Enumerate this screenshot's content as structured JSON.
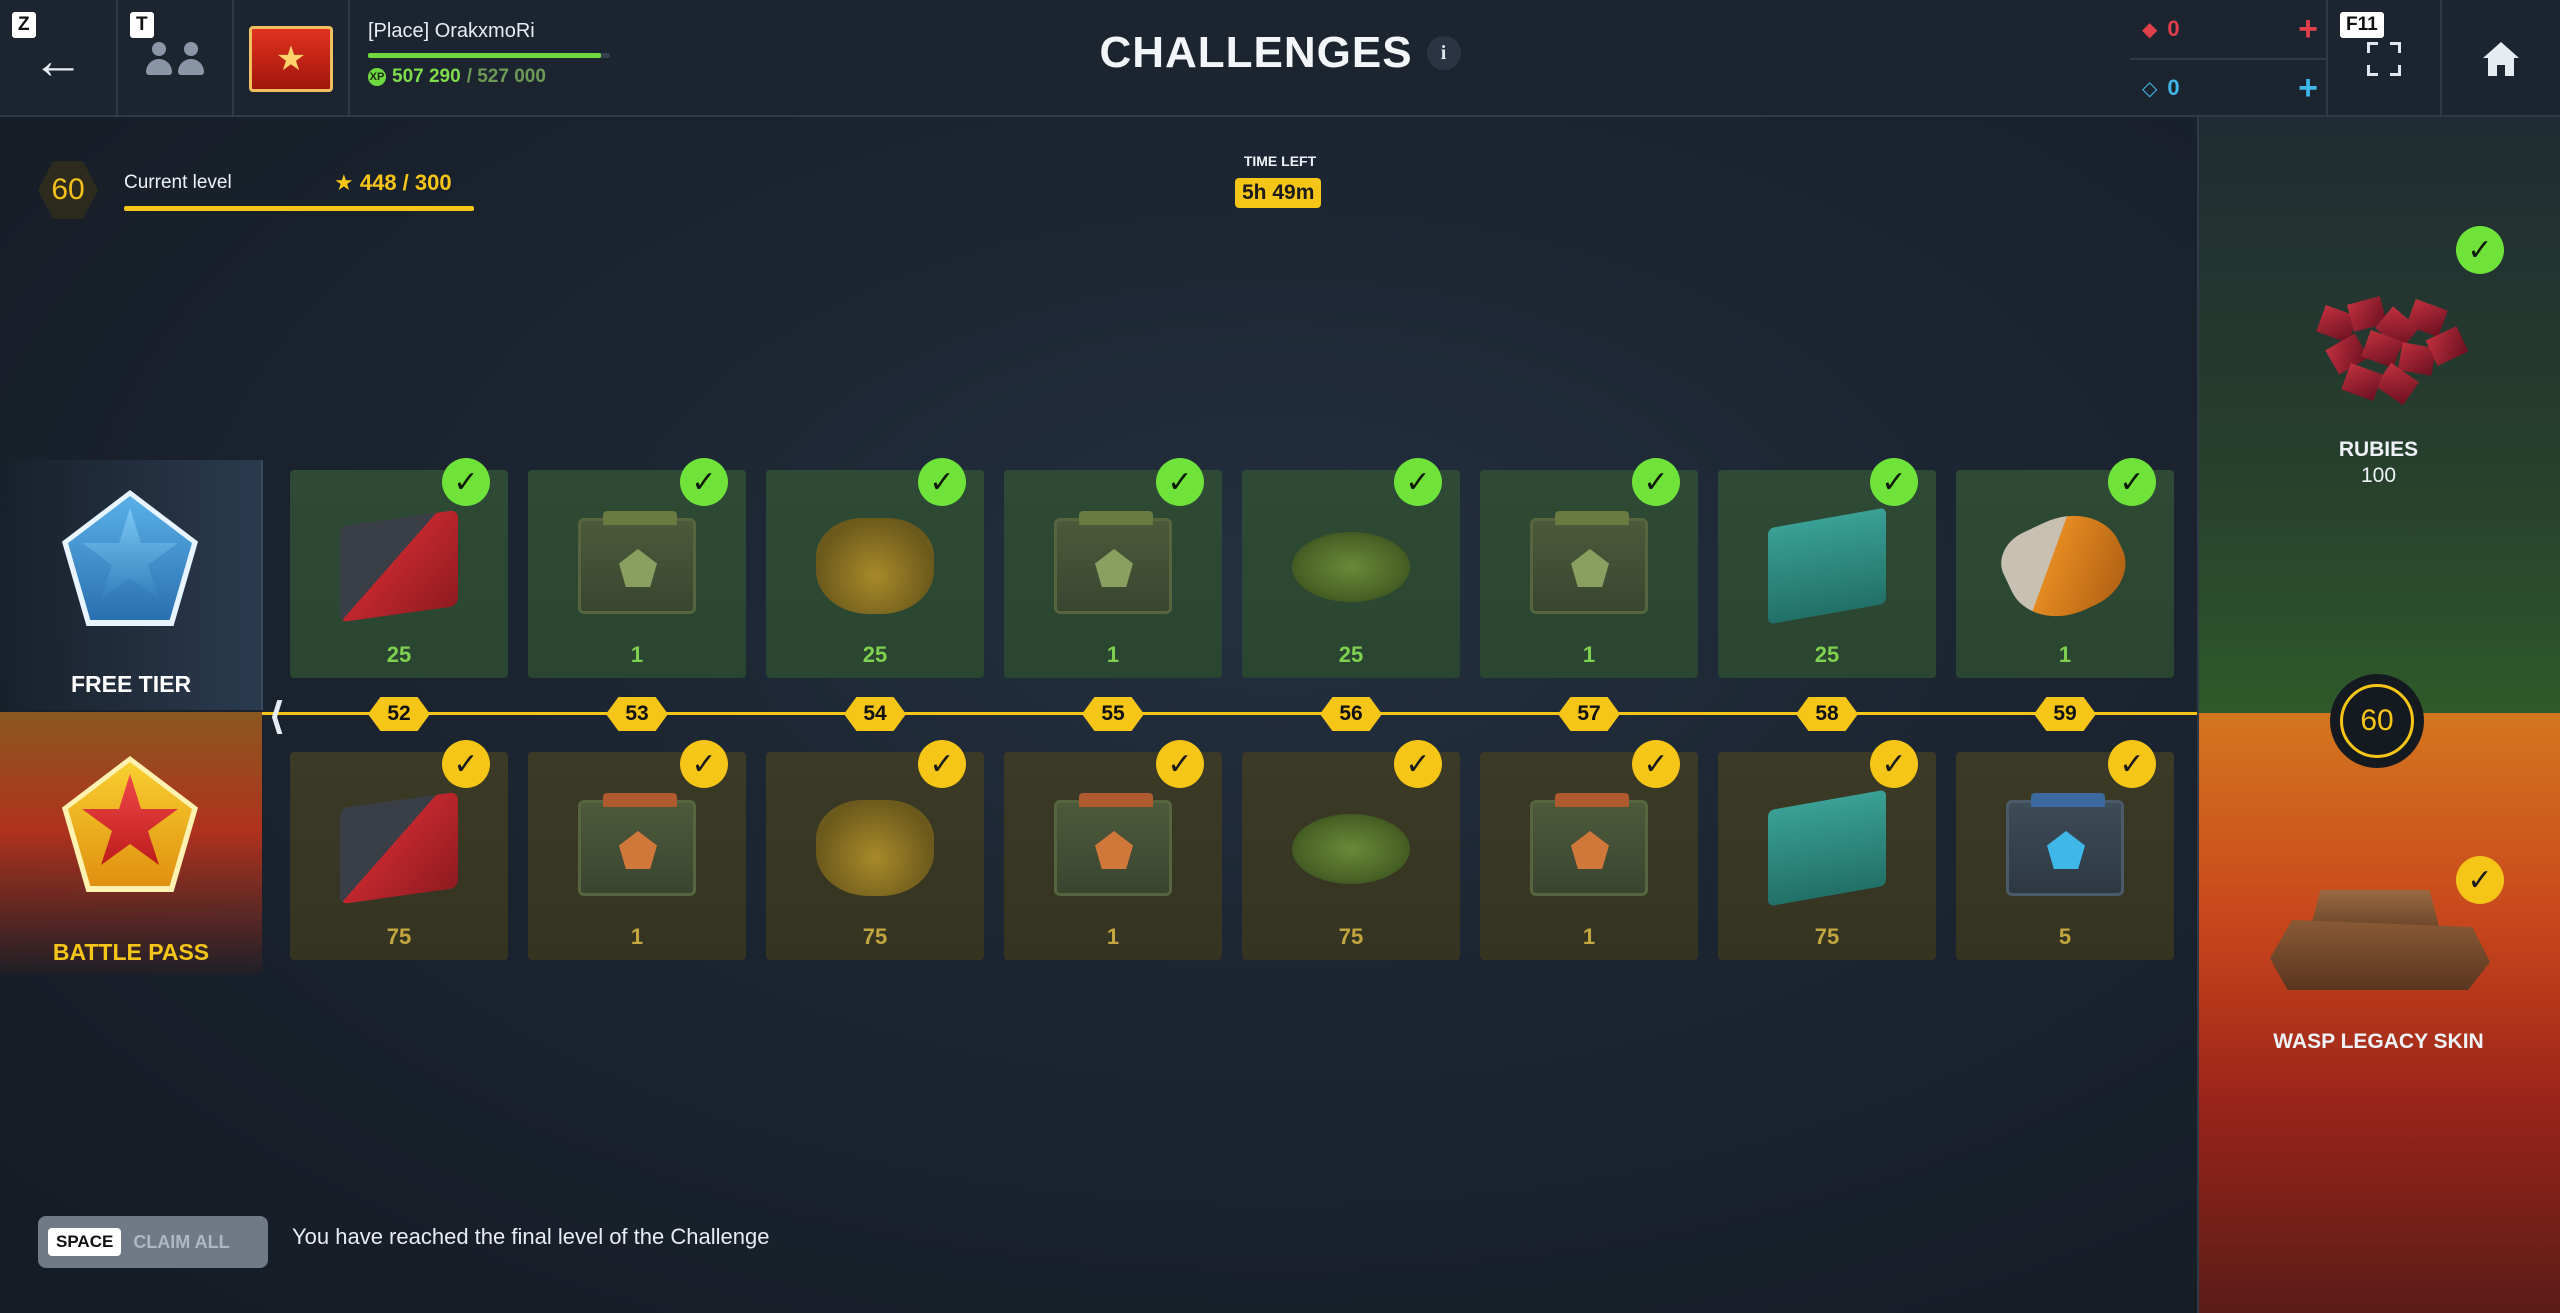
{
  "header": {
    "back_key": "Z",
    "friends_key": "T",
    "fullscreen_key": "F11",
    "title": "CHALLENGES",
    "info_glyph": "i",
    "profile": {
      "name": "[Place] OrakxmoRi",
      "xp_current": "507 290",
      "xp_max": "/ 527 000",
      "xp_fraction": 0.962
    },
    "currency": {
      "red_amount": "0",
      "blue_amount": "0"
    }
  },
  "level": {
    "number": "60",
    "label": "Current level",
    "stars": "448 / 300"
  },
  "time": {
    "label": "TIME LEFT",
    "value": "5h 49m"
  },
  "tiers": {
    "free_label": "FREE TIER",
    "bp_label": "BATTLE PASS"
  },
  "track": {
    "levels": [
      "52",
      "53",
      "54",
      "55",
      "56",
      "57",
      "58",
      "59"
    ]
  },
  "free_rewards": [
    {
      "icon": "ammo-crate",
      "amount": "25"
    },
    {
      "icon": "container-green",
      "amount": "1"
    },
    {
      "icon": "supply-bag",
      "amount": "25"
    },
    {
      "icon": "container-green",
      "amount": "1"
    },
    {
      "icon": "mine",
      "amount": "25"
    },
    {
      "icon": "container-green",
      "amount": "1"
    },
    {
      "icon": "repair-chest",
      "amount": "25"
    },
    {
      "icon": "drone",
      "amount": "1"
    }
  ],
  "bp_rewards": [
    {
      "icon": "ammo-crate",
      "amount": "75"
    },
    {
      "icon": "container-orange",
      "amount": "1"
    },
    {
      "icon": "supply-bag",
      "amount": "75"
    },
    {
      "icon": "container-orange",
      "amount": "1"
    },
    {
      "icon": "mine",
      "amount": "75"
    },
    {
      "icon": "container-orange",
      "amount": "1"
    },
    {
      "icon": "repair-chest",
      "amount": "75"
    },
    {
      "icon": "container-blue",
      "amount": "5"
    }
  ],
  "final_rewards": {
    "free_name": "RUBIES",
    "free_amount": "100",
    "final_level": "60",
    "bp_name": "WASP LEGACY SKIN"
  },
  "footer": {
    "key": "SPACE",
    "claim_label": "CLAIM ALL",
    "message": "You have reached the final level of the Challenge"
  },
  "colors": {
    "accent_yellow": "#f5c518",
    "claimed_green": "#6fe33a",
    "ruby_red": "#e0404a",
    "crystal_cyan": "#3fb7e8"
  }
}
